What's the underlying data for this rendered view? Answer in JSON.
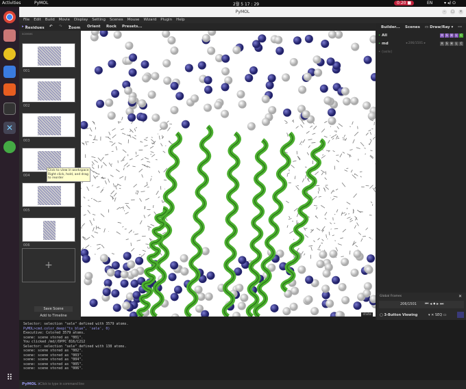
{
  "topbar": {
    "activities": "Activities",
    "app": "PyMOL",
    "clock": "2월 5 17 : 29",
    "record": "0:20 ■",
    "lang": "EN"
  },
  "window": {
    "title": "PyMOL"
  },
  "menu": [
    "File",
    "Edit",
    "Build",
    "Movie",
    "Display",
    "Setting",
    "Scenes",
    "Mouse",
    "Wizard",
    "Plugin",
    "Help"
  ],
  "toolbar": {
    "mode": "Residues",
    "zoom": "Zoom",
    "orient": "Orient",
    "rock": "Rock",
    "presets": "Presets...",
    "builder": "Builder...",
    "scenes": "Scenes",
    "drawray": "Draw/Ray"
  },
  "scenes_panel": {
    "label": "scenes",
    "items": [
      "001",
      "002",
      "003",
      "004",
      "005",
      "006"
    ],
    "add": "+",
    "save": "Save Scene",
    "timeline": "Add to Timeline",
    "tooltip": "Click to view in workspace Right click, hold, and drag to reorder"
  },
  "objects": [
    {
      "name": "All",
      "buttons": [
        "A",
        "S",
        "H",
        "L",
        "C"
      ]
    },
    {
      "name": "md",
      "frame": "206/1501",
      "buttons": [
        "A",
        "S",
        "H",
        "L",
        "C"
      ]
    },
    {
      "name": "(sele)"
    }
  ],
  "frames": {
    "title": "Global Frames",
    "value": "206/1501",
    "mouse_mode": "3-Button Viewing",
    "seq": "SEQ"
  },
  "viewport": {
    "state_label": "state"
  },
  "console": [
    {
      "text": "Selector: selection \"sele\" defined with 3579 atoms.",
      "cmd": false
    },
    {
      "text": "PyMOL>cmd.color_deep(\"ts_blue\", 'sele', 0)",
      "cmd": true
    },
    {
      "text": "Executive: Colored 3579 atoms.",
      "cmd": false
    },
    {
      "text": "scene: scene stored as \"001\".",
      "cmd": false
    },
    {
      "text": "You clicked /md//DPPC`816/C212",
      "cmd": false
    },
    {
      "text": "Selector: selection \"sele\" defined with 138 atoms.",
      "cmd": false
    },
    {
      "text": "scene: scene stored as \"002\".",
      "cmd": false
    },
    {
      "text": "scene: scene stored as \"003\".",
      "cmd": false
    },
    {
      "text": "scene: scene stored as \"004\".",
      "cmd": false
    },
    {
      "text": "scene: scene stored as \"005\".",
      "cmd": false
    },
    {
      "text": "scene: scene stored as \"006\".",
      "cmd": false
    }
  ],
  "cmdline": {
    "prompt": "PyMOL >",
    "placeholder": "Click to type in command line"
  },
  "colors": {
    "accent": "#7a5fd0",
    "helix": "#4cb030",
    "water": "#3a3a9a"
  }
}
